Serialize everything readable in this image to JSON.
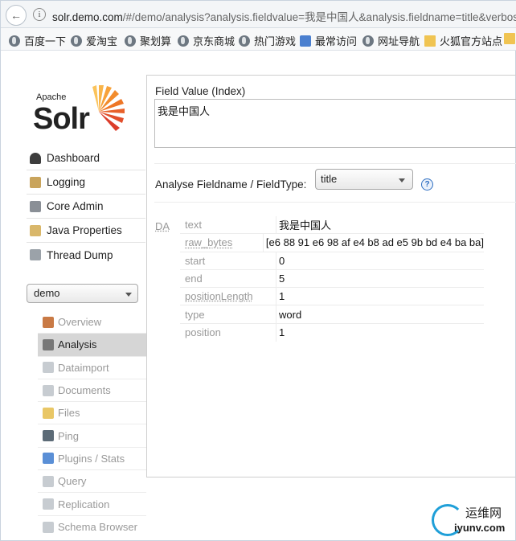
{
  "browser": {
    "url_host": "solr.demo.com",
    "url_rest": "/#/demo/analysis?analysis.fieldvalue=我是中国人&analysis.fieldname=title&verbose_",
    "bookmarks": [
      "百度一下",
      "爱淘宝",
      "聚划算",
      "京东商城",
      "热门游戏",
      "最常访问",
      "网址导航",
      "火狐官方站点"
    ]
  },
  "logo": {
    "line1": "Apache",
    "line2": "Solr"
  },
  "nav": [
    "Dashboard",
    "Logging",
    "Core Admin",
    "Java Properties",
    "Thread Dump"
  ],
  "core_selector": {
    "selected": "demo"
  },
  "core_menu": [
    "Overview",
    "Analysis",
    "Dataimport",
    "Documents",
    "Files",
    "Ping",
    "Plugins / Stats",
    "Query",
    "Replication",
    "Schema Browser"
  ],
  "active_core_menu": "Analysis",
  "analysis": {
    "field_value_label": "Field Value (Index)",
    "field_value": "我是中国人",
    "fieldname_label": "Analyse Fieldname / FieldType:",
    "fieldname_selected": "title",
    "help_symbol": "?",
    "component_tag": "DA",
    "result": [
      {
        "key": "text",
        "value": "我是中国人"
      },
      {
        "key": "raw_bytes",
        "value": "[e6 88 91 e6 98 af e4 b8 ad e5 9b bd e4 ba ba]"
      },
      {
        "key": "start",
        "value": "0"
      },
      {
        "key": "end",
        "value": "5"
      },
      {
        "key": "positionLength",
        "value": "1"
      },
      {
        "key": "type",
        "value": "word"
      },
      {
        "key": "position",
        "value": "1"
      }
    ]
  },
  "watermark": {
    "line1": "运维网",
    "line2": "iyunv.com"
  }
}
